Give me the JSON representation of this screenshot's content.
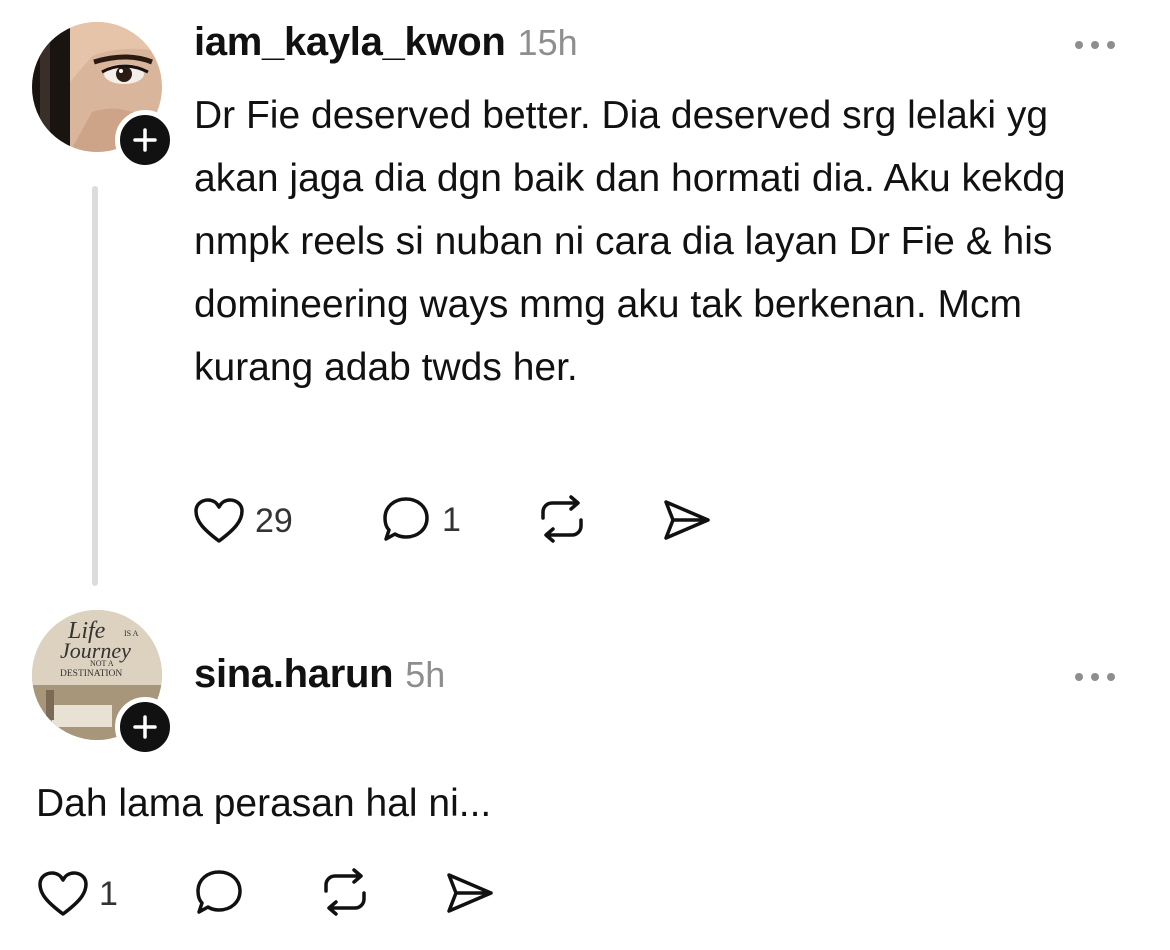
{
  "posts": [
    {
      "username": "iam_kayla_kwon",
      "time": "15h",
      "text": "Dr Fie deserved better. Dia deserved srg lelaki yg akan jaga dia dgn baik dan hormati dia. Aku kekdg nmpk reels si nuban ni cara dia layan Dr Fie & his domineering ways mmg aku tak berkenan. Mcm kurang adab twds her.",
      "likes": "29",
      "replies": "1"
    },
    {
      "username": "sina.harun",
      "time": "5h",
      "text": "Dah lama perasan hal ni...",
      "likes": "1",
      "avatar_text": [
        "Life",
        "IS A",
        "Journey",
        "NOT A",
        "DESTINATION"
      ]
    }
  ],
  "icons": {
    "like": "heart-icon",
    "reply": "comment-icon",
    "repost": "repost-icon",
    "share": "send-icon",
    "follow": "plus-icon",
    "more": "more-dots-icon"
  },
  "colors": {
    "text": "#111111",
    "muted": "#8e8e8e",
    "thread_line": "#dcdcdc"
  }
}
